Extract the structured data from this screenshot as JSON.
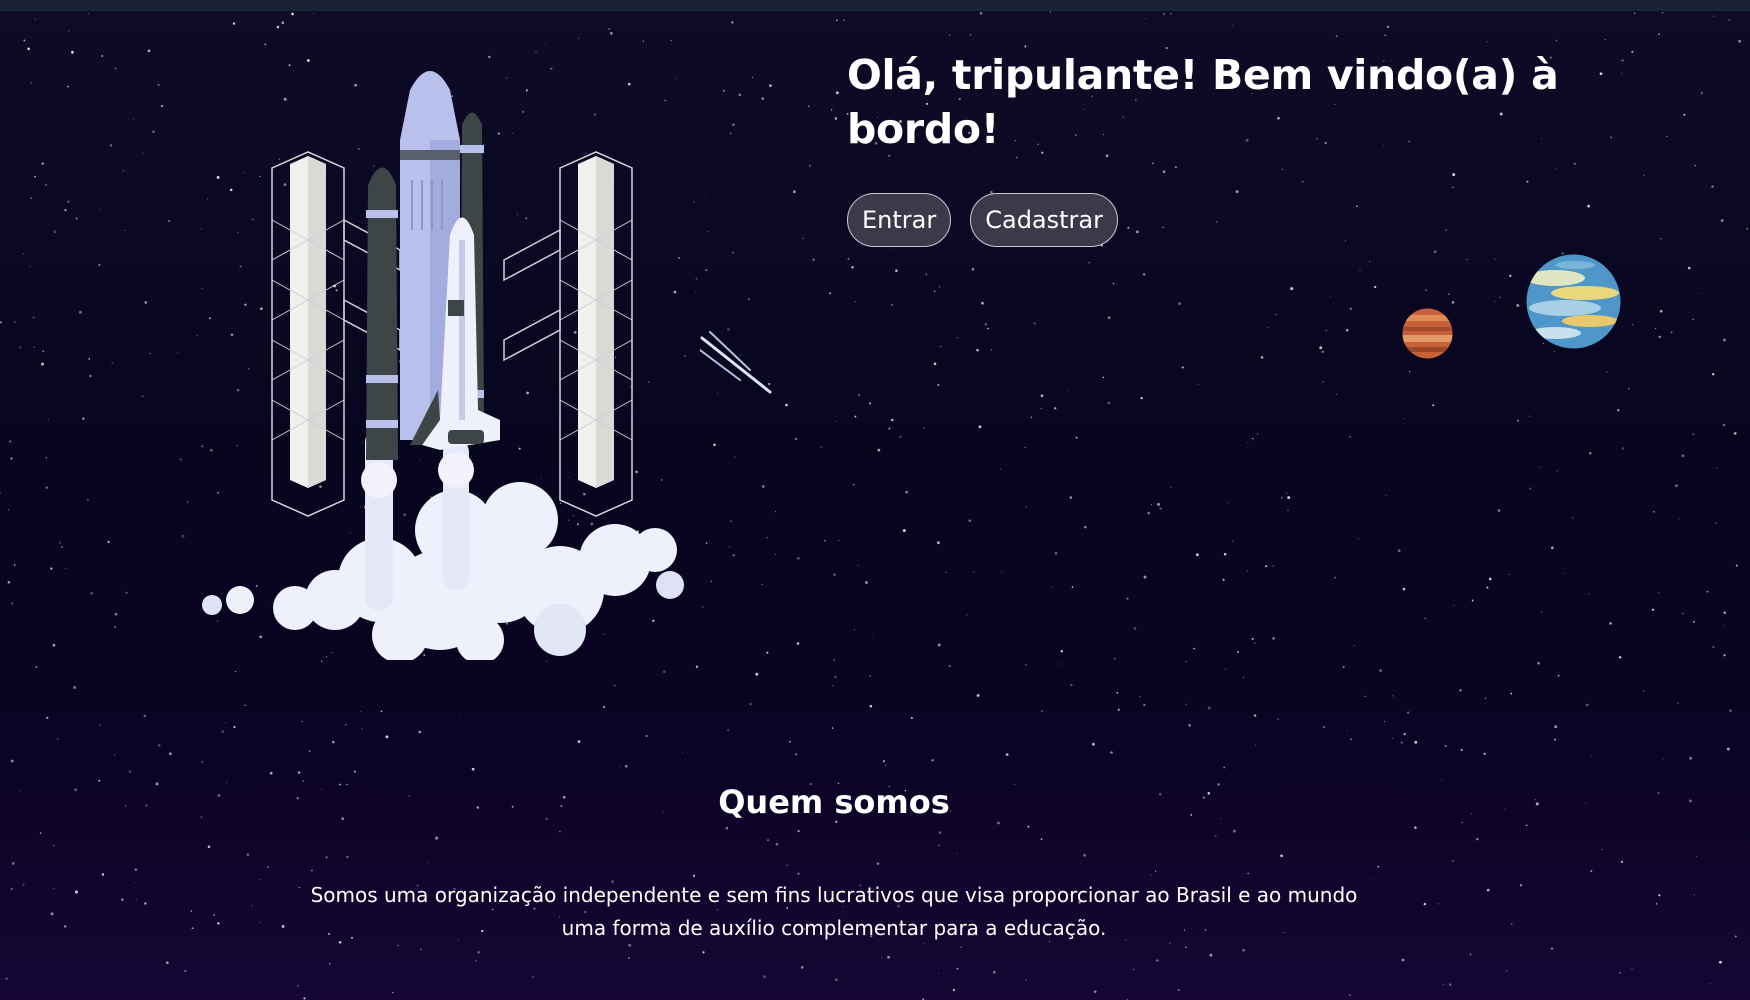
{
  "hero": {
    "title": "Olá, tripulante! Bem vindo(a) à bordo!",
    "buttons": {
      "login_label": "Entrar",
      "register_label": "Cadastrar"
    }
  },
  "about": {
    "title": "Quem somos",
    "text": "Somos uma organização independente e sem fins lucrativos que visa proporcionar ao Brasil e ao mundo uma forma de auxílio complementar para a educação."
  },
  "illustrations": {
    "rocket": "rocket-launch-illustration",
    "comet": "comet-icon",
    "planets": [
      "mars-planet",
      "earth-planet"
    ]
  },
  "colors": {
    "background": "#08051f",
    "button_bg": "#3c3a4a",
    "button_border": "#c8c8d2",
    "text": "#ffffff"
  }
}
